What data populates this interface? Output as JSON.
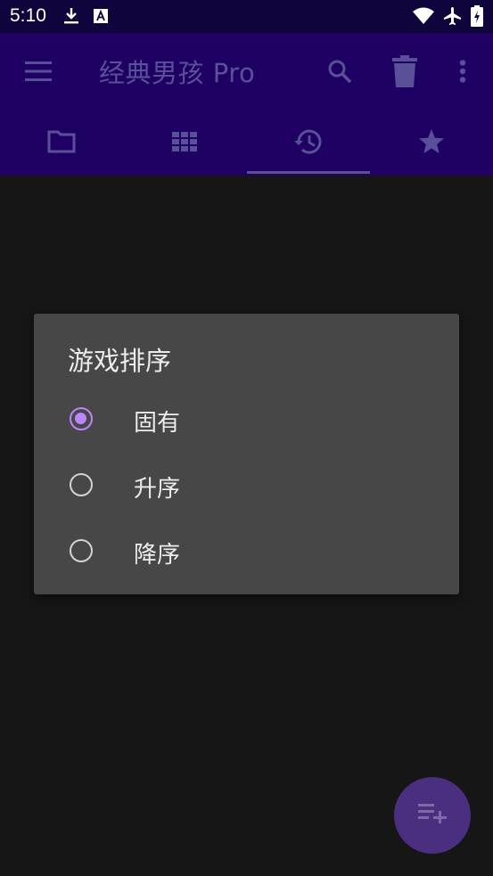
{
  "status_bar": {
    "time": "5:10",
    "icons": [
      "download-icon",
      "a-box-icon",
      "wifi-icon",
      "airplane-icon",
      "battery-icon"
    ]
  },
  "app_bar": {
    "title": "经典男孩 Pro",
    "actions": [
      "menu-icon",
      "search-icon",
      "delete-icon",
      "more-vert-icon"
    ]
  },
  "tabs": [
    {
      "icon": "folder-icon"
    },
    {
      "icon": "grid-icon"
    },
    {
      "icon": "history-icon",
      "selected": true
    },
    {
      "icon": "star-icon"
    }
  ],
  "dialog": {
    "title": "游戏排序",
    "options": [
      {
        "label": "固有",
        "checked": true
      },
      {
        "label": "升序",
        "checked": false
      },
      {
        "label": "降序",
        "checked": false
      }
    ]
  },
  "fab": {
    "icon": "playlist-add-icon"
  },
  "colors": {
    "status_bar": "#10043c",
    "app_bar": "#1f0163",
    "accent": "#bb86fc",
    "dialog_bg": "#474747",
    "scrim": "#161616"
  }
}
